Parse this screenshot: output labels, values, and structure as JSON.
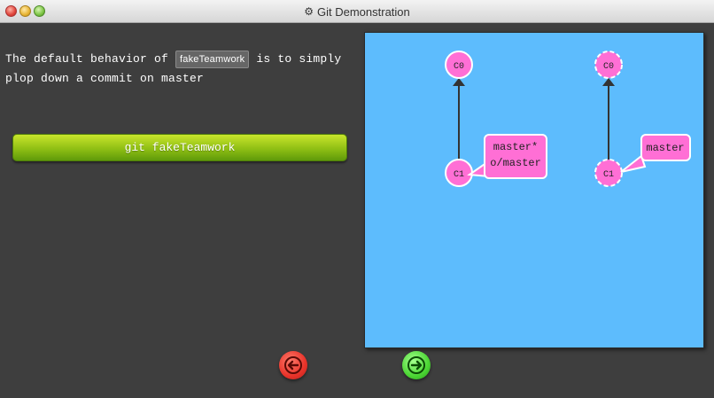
{
  "window": {
    "title": "Git Demonstration",
    "title_icon": "gear-icon"
  },
  "instruction": {
    "text_before": "The default behavior of ",
    "command_chip": "fakeTeamwork",
    "text_after": " is to simply plop down a commit on master"
  },
  "action_button": {
    "label": "git fakeTeamwork"
  },
  "visualization": {
    "background_color": "#5dbcfd",
    "commit_color": "#ff6fd5",
    "left_tree": {
      "commits": [
        "C0",
        "C1"
      ],
      "branch_label_line1": "master*",
      "branch_label_line2": "o/master"
    },
    "right_tree": {
      "commits": [
        "C0",
        "C1"
      ],
      "branch_label": "master"
    }
  },
  "navigation": {
    "prev_icon": "arrow-left-icon",
    "next_icon": "arrow-right-icon",
    "prev_color": "#e8332a",
    "next_color": "#4bd633"
  }
}
